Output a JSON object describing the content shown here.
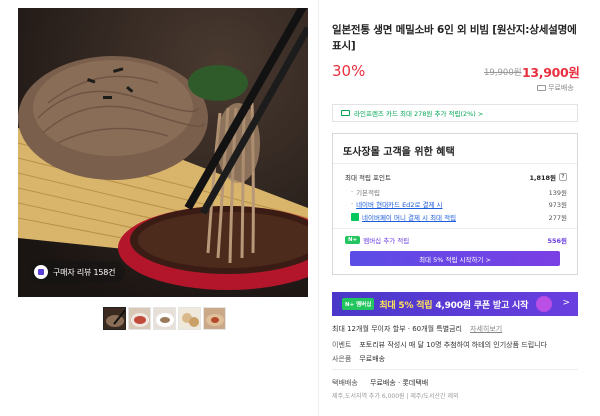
{
  "gallery": {
    "review_badge": "구매자 리뷰 158건",
    "thumbnails": [
      "thumb-1",
      "thumb-2",
      "thumb-3",
      "thumb-4",
      "thumb-5"
    ]
  },
  "product": {
    "title": "일본전통 생면 메밀소바 6인 외 비빔 [원산지:상세설명에 표시]",
    "discount": "30%",
    "original_price": "19,900원",
    "sale_price": "13,900원",
    "shipping_badge": "무료배송"
  },
  "card_promo": {
    "text": "라인프렌즈 카드 최대 278원 추가 적립(2%) >"
  },
  "benefits": {
    "title": "또사장몰 고객을 위한 혜택",
    "max_points_label": "최대 적립 포인트",
    "max_points_value": "1,818원",
    "help": "?",
    "rows": [
      {
        "label": "기본적립",
        "value": "139원"
      },
      {
        "label": "네이버 현대카드 Ed2로 결제 시",
        "value": "973원"
      },
      {
        "label": "네이버페이 머니 결제 시 최대 적립",
        "value": "277원"
      }
    ],
    "membership_badge": "N+",
    "membership_label": "멤버십 추가 적립",
    "membership_value": "556원",
    "membership_button": "최대 5% 적립 시작하기 >"
  },
  "coupon_banner": {
    "badge": "N+ 멤버십",
    "text_prefix": "최대 5% 적립",
    "text_suffix": "4,900원 쿠폰 받고 시작",
    "arrow": ">"
  },
  "info": {
    "installment": "최대 12개월 무이자 할부 · 60개월 특별금리",
    "installment_more": "자세히보기",
    "event_label": "이벤트",
    "event_text": "포토리뷰 작성시 매 달 10명 추첨하여 하테의 인기상품 드립니다",
    "gift_label": "사은품",
    "gift_text": "무료배송"
  },
  "delivery": {
    "label": "택배배송",
    "value": "무료배송 · 롯데택배",
    "sub": "제주,도서지역 추가 6,000원 | 제주/도서산간 제외"
  },
  "colors": {
    "accent_red": "#e8303f",
    "npay_green": "#03c75a",
    "membership_purple": "#5b4ce6"
  }
}
